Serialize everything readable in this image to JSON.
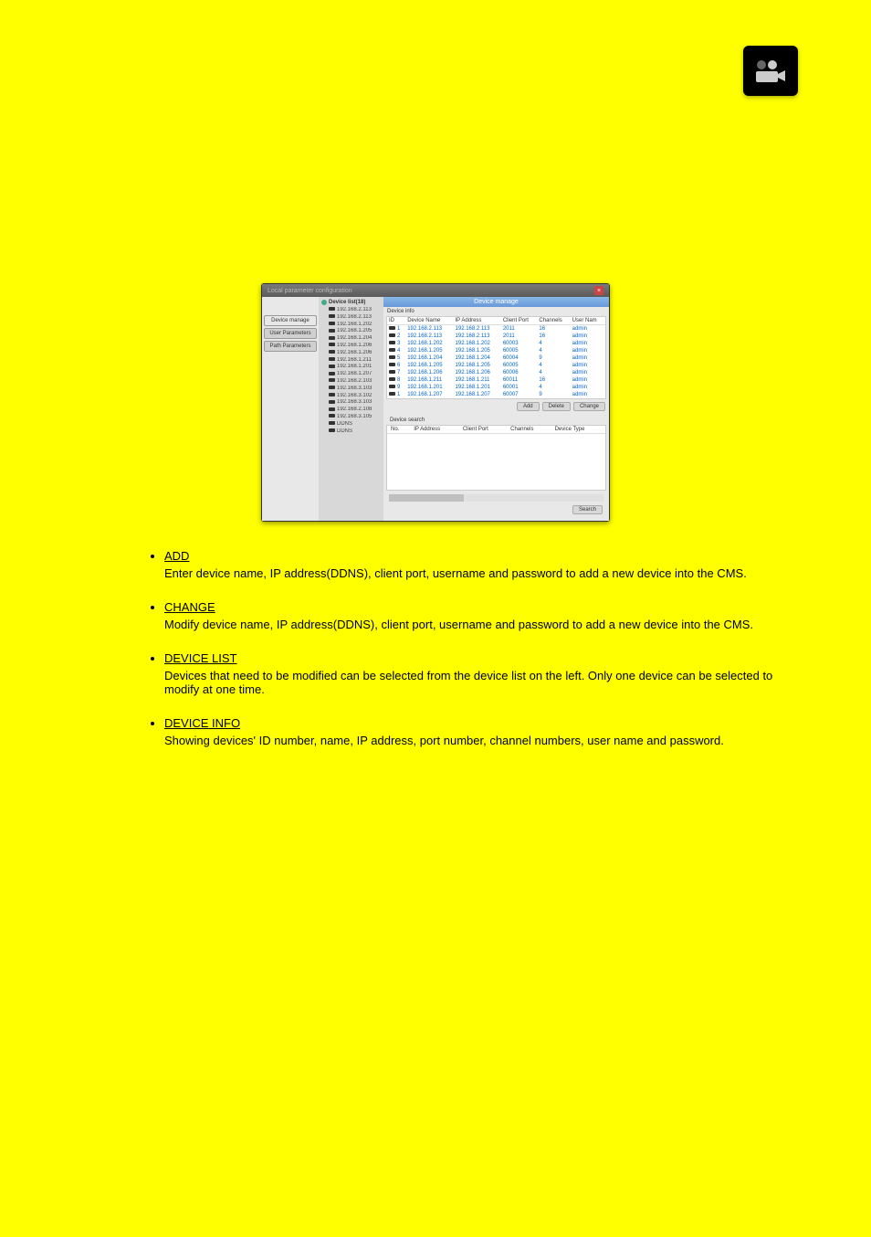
{
  "app_icon": "camera-app-icon",
  "window": {
    "title": "Local parameter configuration",
    "section_title": "Device manage"
  },
  "tabs": {
    "device_manage": "Device manage",
    "user_parameters": "User Parameters",
    "path_parameters": "Path Parameters"
  },
  "device_list": {
    "header": "Device list(18)",
    "items": [
      "192.168.2.113",
      "192.168.2.113",
      "192.168.1.202",
      "192.168.1.205",
      "192.168.1.204",
      "192.168.1.206",
      "192.168.1.206",
      "192.168.1.211",
      "192.168.1.201",
      "192.168.1.207",
      "192.168.2.103",
      "192.168.3.103",
      "192.168.3.102",
      "192.168.3.103",
      "192.168.2.108",
      "192.168.3.105",
      "DDNS",
      "DDNS"
    ]
  },
  "device_info": {
    "title": "Device info",
    "headers": [
      "ID",
      "Device Name",
      "IP Address",
      "Client Port",
      "Channels",
      "User Nam"
    ],
    "rows": [
      {
        "id": "1",
        "name": "192.168.2.113",
        "ip": "192.168.2.113",
        "port": "2011",
        "ch": "16",
        "user": "admin"
      },
      {
        "id": "2",
        "name": "192.168.2.113",
        "ip": "192.168.2.113",
        "port": "2011",
        "ch": "16",
        "user": "admin"
      },
      {
        "id": "3",
        "name": "192.168.1.202",
        "ip": "192.168.1.202",
        "port": "60003",
        "ch": "4",
        "user": "admin"
      },
      {
        "id": "4",
        "name": "192.168.1.205",
        "ip": "192.168.1.205",
        "port": "60005",
        "ch": "4",
        "user": "admin"
      },
      {
        "id": "5",
        "name": "192.168.1.204",
        "ip": "192.168.1.204",
        "port": "60004",
        "ch": "9",
        "user": "admin"
      },
      {
        "id": "6",
        "name": "192.168.1.205",
        "ip": "192.168.1.205",
        "port": "60005",
        "ch": "4",
        "user": "admin"
      },
      {
        "id": "7",
        "name": "192.168.1.206",
        "ip": "192.168.1.206",
        "port": "60006",
        "ch": "4",
        "user": "admin"
      },
      {
        "id": "8",
        "name": "192.168.1.211",
        "ip": "192.168.1.211",
        "port": "60011",
        "ch": "16",
        "user": "admin"
      },
      {
        "id": "9",
        "name": "192.168.1.201",
        "ip": "192.168.1.201",
        "port": "60001",
        "ch": "4",
        "user": "admin"
      },
      {
        "id": "1",
        "name": "192.168.1.207",
        "ip": "192.168.1.207",
        "port": "60007",
        "ch": "9",
        "user": "admin"
      }
    ],
    "buttons": {
      "add": "Add",
      "delete": "Delete",
      "change": "Change"
    }
  },
  "device_search": {
    "title": "Device search",
    "headers": [
      "No.",
      "IP Address",
      "Client Port",
      "Channels",
      "Device Type"
    ],
    "button": "Search"
  },
  "bullets": {
    "add": {
      "heading": "ADD",
      "desc": "Enter device name, IP address(DDNS), client port, username and password to add a new device into the CMS."
    },
    "change": {
      "heading": "CHANGE",
      "desc": "Modify device name, IP address(DDNS), client port, username and password to add a new device into the CMS."
    },
    "device_list": {
      "heading": "DEVICE LIST",
      "desc": "Devices that need to be modified can be selected from the device list on the left. Only one device can be selected to modify at one time."
    },
    "device_info": {
      "heading": "DEVICE INFO",
      "desc": "Showing devices' ID number, name, IP address, port number, channel numbers, user name and password."
    }
  }
}
